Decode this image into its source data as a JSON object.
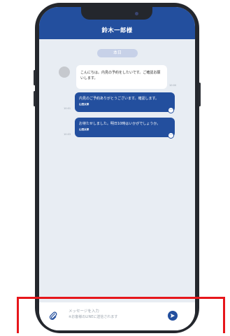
{
  "header": {
    "title": "鈴木一郎様"
  },
  "chat": {
    "date_label": "本日",
    "messages": [
      {
        "direction": "incoming",
        "text": "こんにちは。内見の予約をしたいです。ご確認お願いします。",
        "time": "10:00"
      },
      {
        "direction": "outgoing",
        "text": "内見のご予約ありがとうございます。確認します。",
        "sender": "山田太郎",
        "time": "10:01"
      },
      {
        "direction": "outgoing",
        "text": "お待たせしました。明日10時はいかがでしょうか。",
        "sender": "山田太郎",
        "time": "10:03"
      }
    ]
  },
  "composer": {
    "placeholder": "メッセージを入力",
    "hint": "※お客様のLINEに送信されます",
    "attach_icon": "paperclip-icon",
    "send_icon": "send-icon"
  },
  "colors": {
    "brand": "#234f9e",
    "background": "#e8edf3",
    "highlight": "#e6161b"
  }
}
